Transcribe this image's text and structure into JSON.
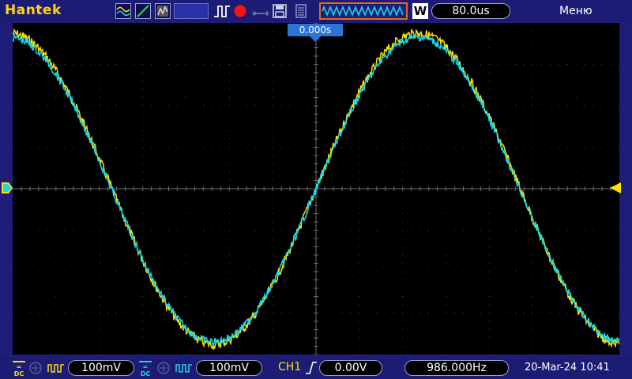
{
  "toolbar": {
    "brand": "Hantek",
    "timebase": "80.0us",
    "menu_label": "Меню",
    "w_label": "W",
    "icons": [
      "ch-wave-icon",
      "trigger-slope-icon",
      "memory-depth-icon",
      "pulse-icon",
      "record-icon",
      "usb-icon",
      "save-icon",
      "print-icon",
      "waveform-mode-icon"
    ]
  },
  "screen": {
    "time_ref": "0.000s"
  },
  "bottom": {
    "ch1": {
      "coupling": "DC",
      "scale": "100mV",
      "color": "#ffe000"
    },
    "ch2": {
      "coupling": "DC",
      "scale": "100mV",
      "color": "#18d8e8"
    },
    "trigger": {
      "source": "CH1",
      "level": "0.00V"
    },
    "frequency": "986.000Hz",
    "datetime": "20-Mar-24 10:41"
  },
  "colors": {
    "ch1": "#ffe000",
    "ch2": "#18d8e8",
    "accent": "#e46a14",
    "frame": "#1e1e78"
  }
}
